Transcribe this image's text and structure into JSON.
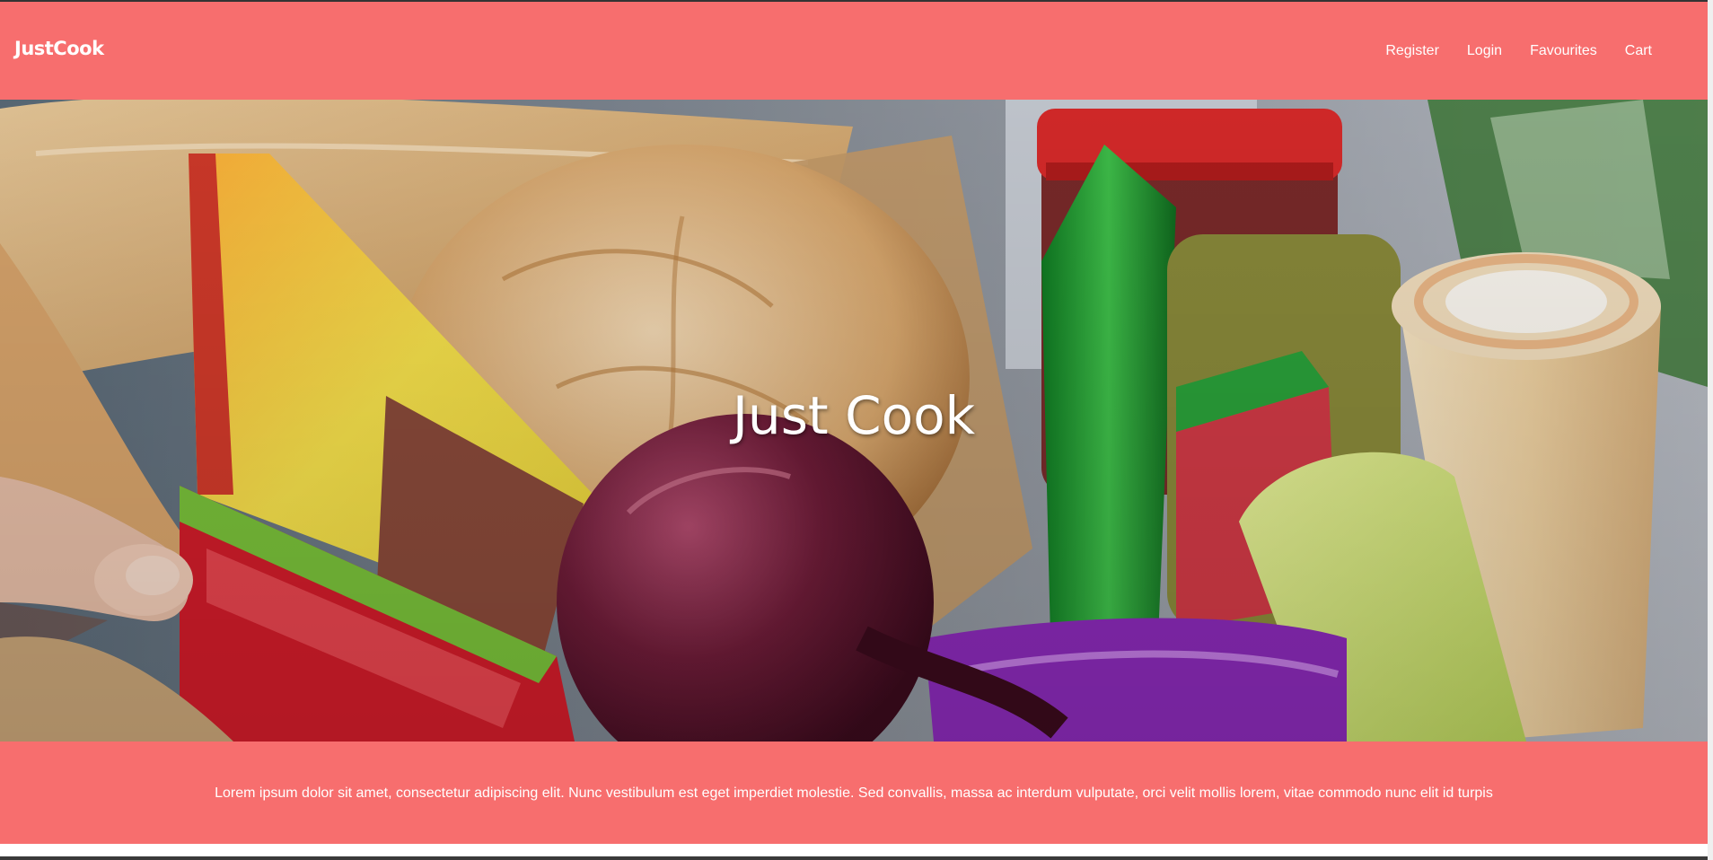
{
  "navbar": {
    "brand": "JustCook",
    "links": [
      {
        "label": "Register"
      },
      {
        "label": "Login"
      },
      {
        "label": "Favourites"
      },
      {
        "label": "Cart"
      }
    ],
    "background_color": "#f76e6e"
  },
  "hero": {
    "title": "Just Cook",
    "image_description_icon": "grocery-bag-photo"
  },
  "footer": {
    "text": "Lorem ipsum dolor sit amet, consectetur adipiscing elit. Nunc vestibulum est eget imperdiet molestie. Sed convallis, massa ac interdum vulputate, orci velit mollis lorem, vitae commodo nunc elit id turpis",
    "background_color": "#f76e6e"
  }
}
